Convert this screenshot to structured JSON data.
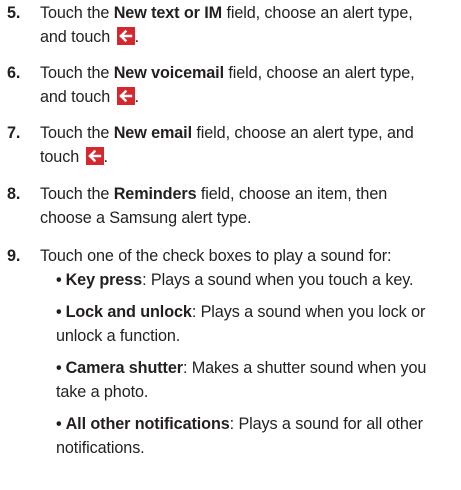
{
  "steps": [
    {
      "number": "5.",
      "line1_pre": "Touch the ",
      "field": "New text or IM",
      "line1_post": " field, choose an alert type,",
      "line2": "and touch ",
      "end": "."
    },
    {
      "number": "6.",
      "line1_pre": "Touch the ",
      "field": "New voicemail",
      "line1_post": " field, choose an alert type,",
      "line2": "and touch ",
      "end": "."
    },
    {
      "number": "7.",
      "line1_pre": "Touch the ",
      "field": "New email",
      "line1_post": " field, choose an alert type, and",
      "line2": "touch ",
      "end": "."
    },
    {
      "number": "8.",
      "line1_pre": "Touch the ",
      "field": "Reminders",
      "line1_post": " field, choose an item, then",
      "line2": "choose a Samsung alert type."
    },
    {
      "number": "9.",
      "line1": "Touch one of the check boxes to play a sound for:"
    }
  ],
  "bullets": [
    {
      "dot": "•",
      "term": "Key press",
      "line1": ": Plays a sound when you touch a key."
    },
    {
      "dot": "•",
      "term": "Lock and unlock",
      "line1": ": Plays a sound when you lock or",
      "line2": "unlock a function."
    },
    {
      "dot": "•",
      "term": "Camera shutter",
      "line1": ": Makes a shutter sound when you",
      "line2": "take a photo."
    },
    {
      "dot": "•",
      "term": "All other notifications",
      "line1": ": Plays a sound for all other",
      "line2": "notifications."
    }
  ],
  "icons": {
    "back": "back-arrow-icon",
    "back_color": "#d8262e"
  }
}
